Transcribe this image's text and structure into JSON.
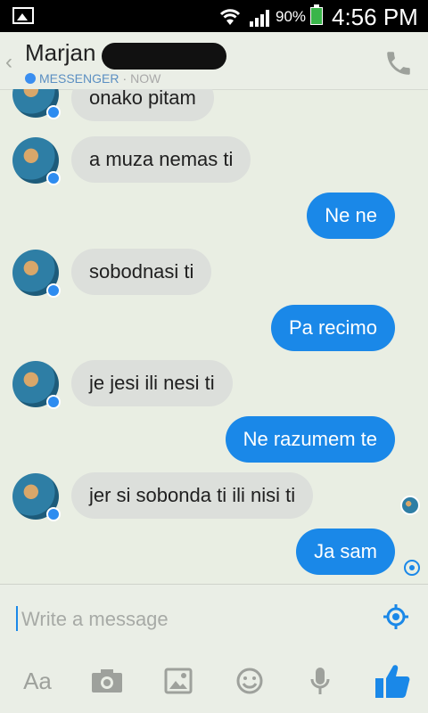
{
  "status_bar": {
    "battery": "90%",
    "time": "4:56 PM"
  },
  "header": {
    "contact_name": "Marjan",
    "platform": "MESSENGER",
    "separator": "·",
    "last_active": "NOW"
  },
  "messages": [
    {
      "side": "in",
      "text": "onako pitam"
    },
    {
      "side": "in",
      "text": "a muza nemas ti"
    },
    {
      "side": "out",
      "text": "Ne ne"
    },
    {
      "side": "in",
      "text": "sobodnasi ti"
    },
    {
      "side": "out",
      "text": "Pa recimo"
    },
    {
      "side": "in",
      "text": "je jesi ili nesi ti"
    },
    {
      "side": "out",
      "text": "Ne razumem te"
    },
    {
      "side": "in",
      "text": "jer si sobonda ti ili nisi ti"
    },
    {
      "side": "out",
      "text": "Ja sam"
    }
  ],
  "composer": {
    "placeholder": "Write a message",
    "text_style_label": "Aa"
  },
  "colors": {
    "accent": "#1a88e8",
    "incoming_bubble": "#dcdfdb",
    "background": "#e9eee3"
  }
}
